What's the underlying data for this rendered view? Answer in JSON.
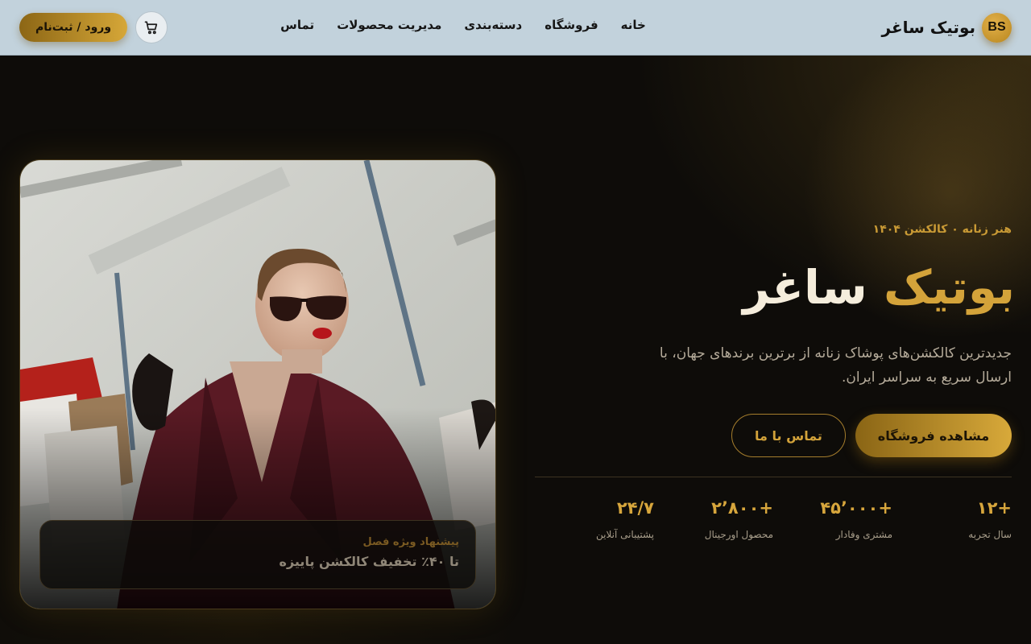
{
  "header": {
    "brand_badge": "BS",
    "brand_name": "بوتیک ساغر",
    "nav": [
      "خانه",
      "فروشگاه",
      "دسته‌بندی",
      "مدیریت محصولات",
      "تماس"
    ],
    "login_label": "ورود / ثبت‌نام",
    "cart_icon": "cart-icon"
  },
  "hero": {
    "eyebrow": "هنر زنانه ۰ کالکشن ۱۴۰۴",
    "title_gold": "بوتیک",
    "title_cream": "ساغر",
    "description": "جدیدترین کالکشن‌های پوشاک زنانه از برترین برندهای جهان، با ارسال سریع به سراسر ایران.",
    "primary_button": "مشاهده فروشگاه",
    "secondary_button": "تماس با ما",
    "stats": [
      {
        "value": "+۱۲",
        "label": "سال تجربه"
      },
      {
        "value": "+۴۵٬۰۰۰",
        "label": "مشتری وفادار"
      },
      {
        "value": "+۲٬۸۰۰",
        "label": "محصول اورجینال"
      },
      {
        "value": "۲۴/۷",
        "label": "پشتیبانی آنلاین"
      }
    ]
  },
  "promo": {
    "tag": "پیشنهاد ویژه فصل",
    "text": "تا ۴۰٪ تخفیف کالکشن پاییزه"
  },
  "colors": {
    "accent_gold": "#d4a33a",
    "header_bg": "#c2d2dc",
    "hero_bg": "#0e0c09"
  }
}
